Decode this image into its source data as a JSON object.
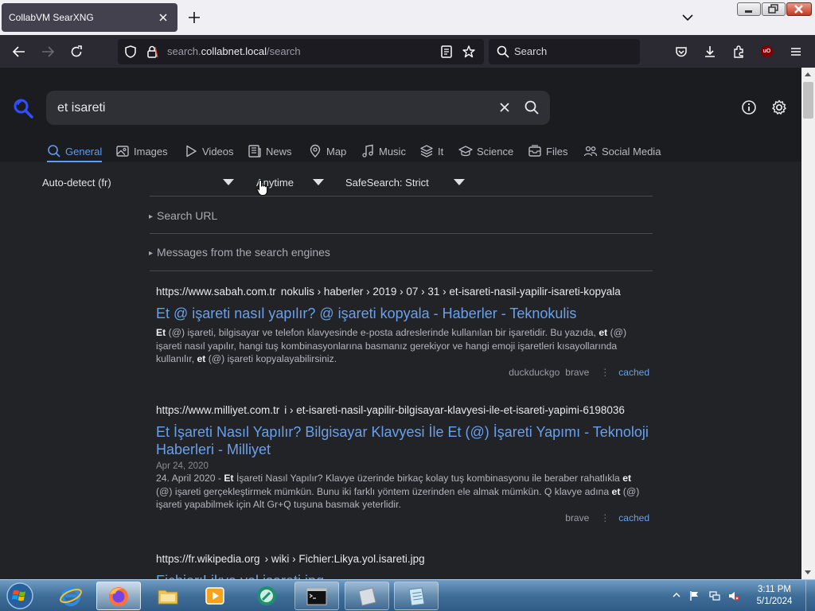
{
  "browser": {
    "tab_title": "CollabVM SearXNG",
    "url_prefix": "search.",
    "url_host": "collabnet.local",
    "url_path": "/search",
    "search_placeholder": "Search"
  },
  "search": {
    "query": "et isareti"
  },
  "categories": [
    {
      "label": "General",
      "icon": "search-icon",
      "active": true
    },
    {
      "label": "Images",
      "icon": "image-icon"
    },
    {
      "label": "Videos",
      "icon": "play-icon"
    },
    {
      "label": "News",
      "icon": "newspaper-icon"
    },
    {
      "label": "Map",
      "icon": "map-pin-icon"
    },
    {
      "label": "Music",
      "icon": "music-note-icon"
    },
    {
      "label": "It",
      "icon": "layers-icon"
    },
    {
      "label": "Science",
      "icon": "school-icon"
    },
    {
      "label": "Files",
      "icon": "file-tray-icon"
    },
    {
      "label": "Social Media",
      "icon": "people-icon"
    }
  ],
  "filters": {
    "language": "Auto-detect (fr)",
    "time_range": "Anytime",
    "safesearch": "SafeSearch: Strict"
  },
  "details": {
    "search_url": "Search URL",
    "engine_messages": "Messages from the search engines"
  },
  "results": [
    {
      "url_host": "https://www.sabah.com.tr",
      "url_path": "nokulis › haberler › 2019 › 07 › 31 › et-isareti-nasil-yapilir-isareti-kopyala",
      "title": "Et @ işareti nasıl yapılır? @ işareti kopyala - Haberler - Teknokulis",
      "engines": [
        "duckduckgo",
        "brave"
      ],
      "cached": "cached"
    },
    {
      "url_host": "https://www.milliyet.com.tr",
      "url_path": "i › et-isareti-nasil-yapilir-bilgisayar-klavyesi-ile-et-isareti-yapimi-6198036",
      "title": "Et İşareti Nasıl Yapılır? Bilgisayar Klavyesi İle Et (@) İşareti Yapımı - Teknoloji Haberleri - Milliyet",
      "date": "Apr 24, 2020",
      "engines": [
        "brave"
      ],
      "cached": "cached"
    },
    {
      "url_host": "https://fr.wikipedia.org",
      "url_path": "› wiki › Fichier:Likya.yol.isareti.jpg",
      "title": "Fichier:Likya yol isareti.jpg"
    }
  ],
  "result_snippets": {
    "r0": [
      "Et",
      " (@) işareti, bilgisayar ve telefon klavyesinde e-posta adreslerinde kullanılan bir işaretidir. Bu yazıda, ",
      "et",
      " (@) işareti nasıl yapılır, hangi tuş kombinasyonlarına basmanız gerekiyor ve hangi emoji işaretleri kısayollarında kullanılır, ",
      "et",
      " (@) işareti kopyalayabilirsiniz."
    ],
    "r1": [
      "24. April 2020 - ",
      "Et",
      " İşareti Nasıl Yapılır? Klavye üzerinde birkaç kolay tuş kombinasyonu ile beraber rahatlıkla ",
      "et",
      " (@) işareti gerçekleştirmek mümkün. Bunu iki farklı yöntem üzerinden ele almak mümkün. Q klavye adına ",
      "et",
      " (@) işareti yapabilmek için Alt Gr+Q tuşuna basmak yeterlidir."
    ]
  },
  "taskbar": {
    "time": "3:11 PM",
    "date": "5/1/2024"
  },
  "colors": {
    "accent": "#5c9cf5",
    "link": "#6aa0ea",
    "page_bg": "#222327"
  }
}
